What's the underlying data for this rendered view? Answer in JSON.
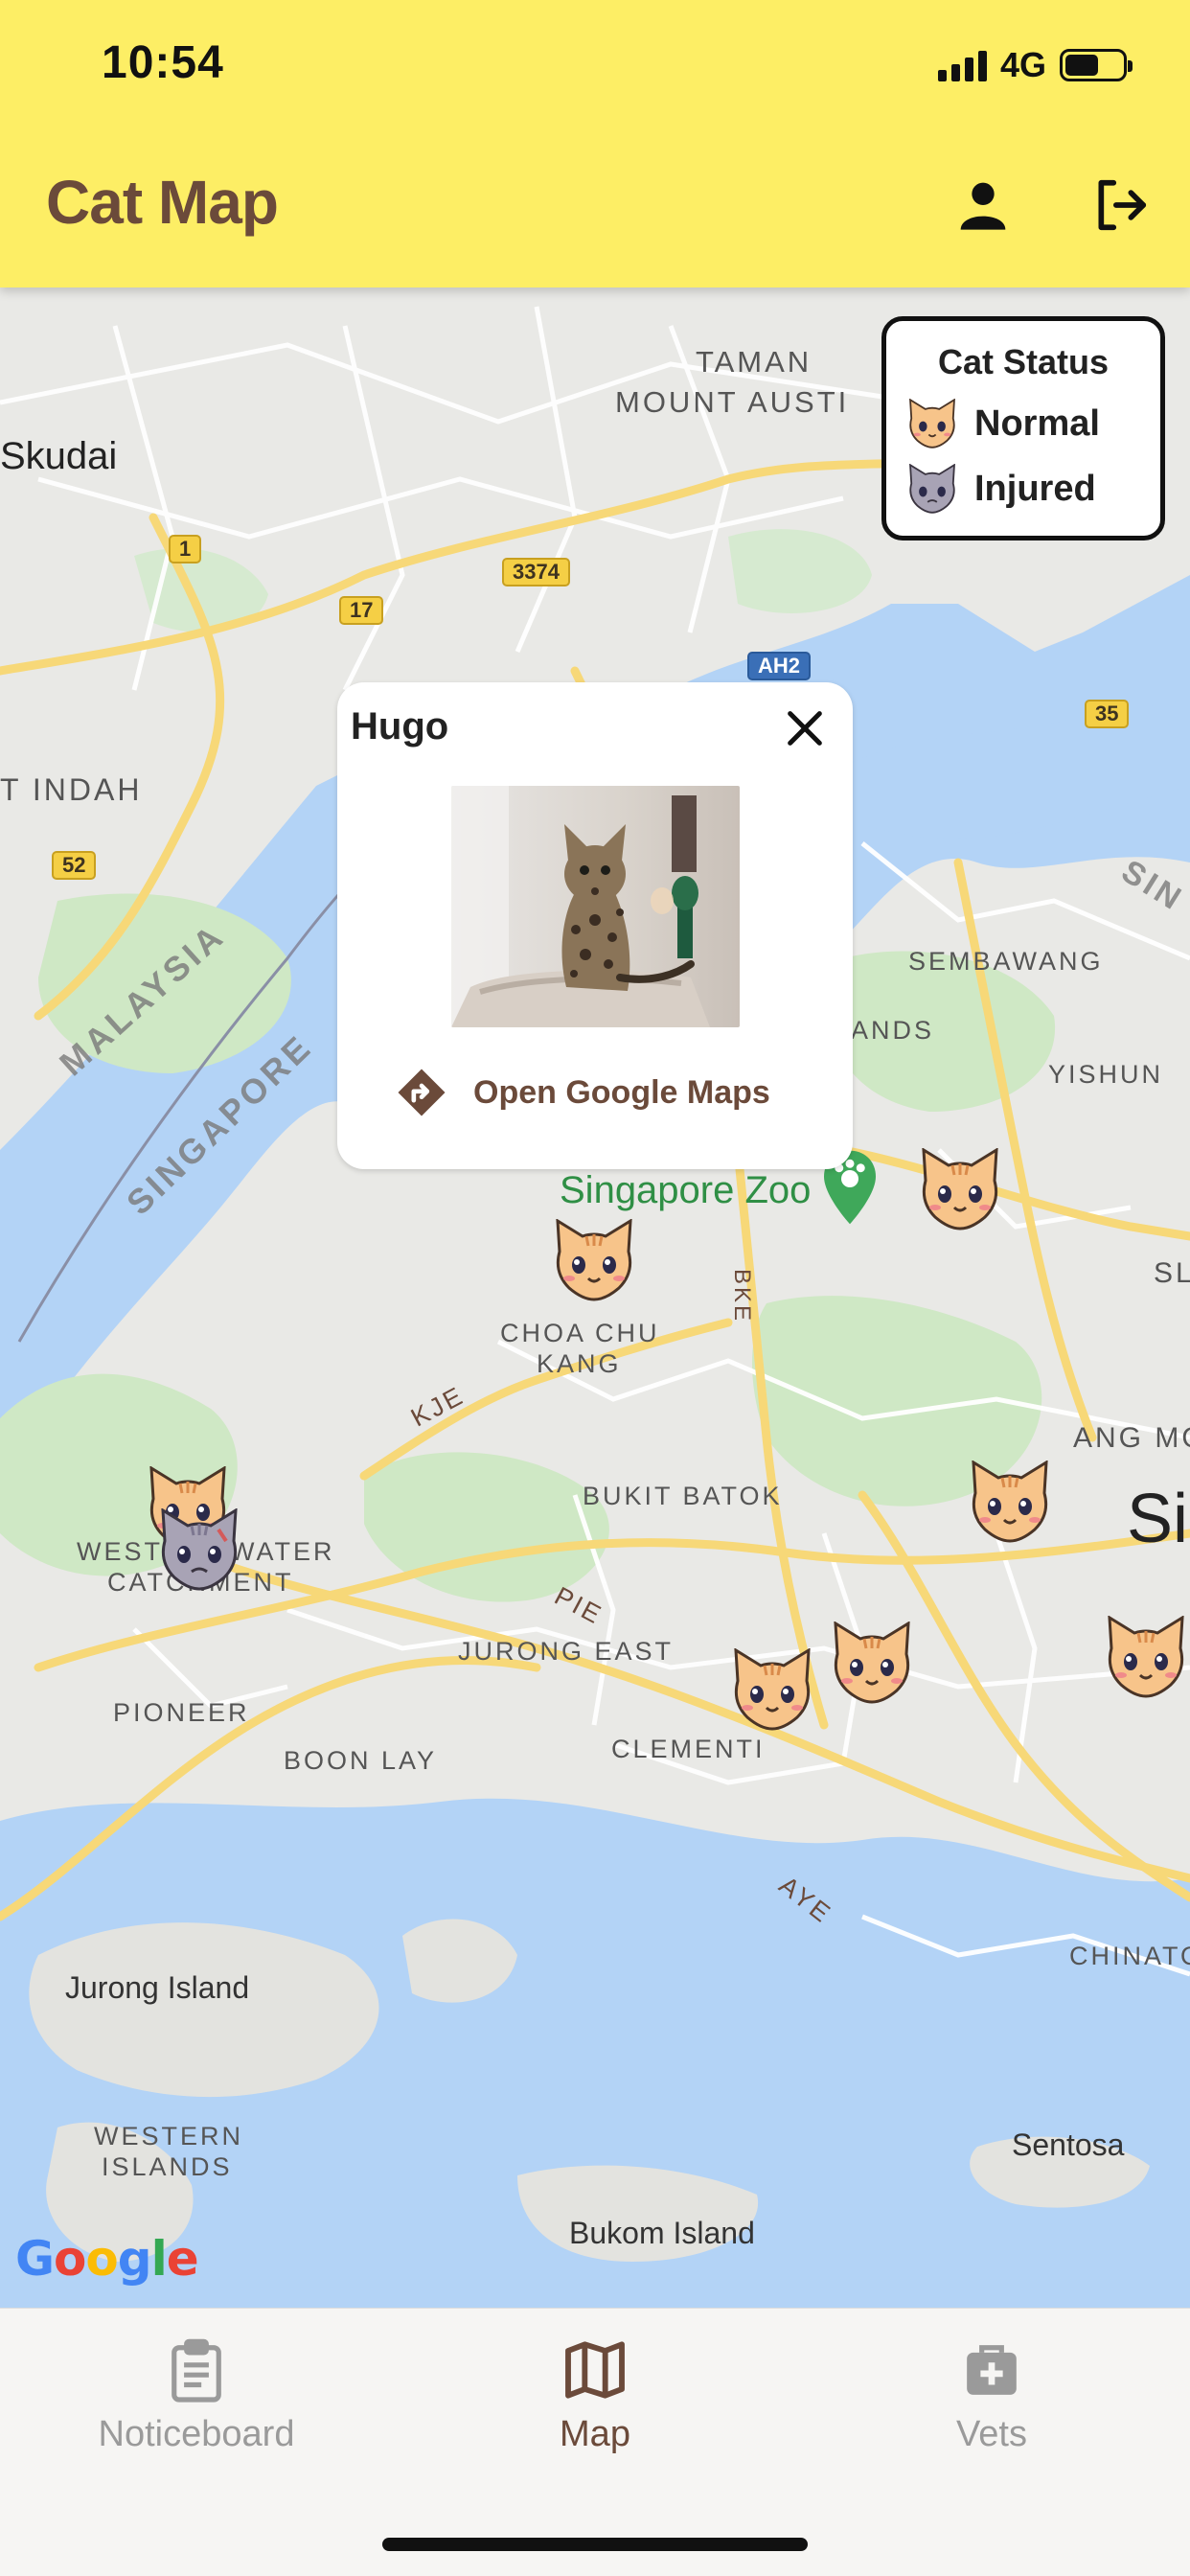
{
  "status_bar": {
    "time": "10:54",
    "network": "4G"
  },
  "header": {
    "title": "Cat Map",
    "profile_icon": "person-icon",
    "logout_icon": "logout-icon"
  },
  "legend": {
    "title": "Cat Status",
    "items": [
      {
        "label": "Normal",
        "icon": "normal-cat-icon",
        "color": "#f7c48a"
      },
      {
        "label": "Injured",
        "icon": "injured-cat-icon",
        "color": "#a8a3b5"
      }
    ]
  },
  "popup": {
    "name": "Hugo",
    "close_icon": "close-icon",
    "photo_alt": "photo of a cat",
    "link_label": "Open Google Maps",
    "link_icon": "directions-icon"
  },
  "map": {
    "labels": {
      "skudai": "Skudai",
      "taman_1": "TAMAN",
      "taman_2": "MOUNT AUSTI",
      "indah": "T INDAH",
      "sembawang": "SEMBAWANG",
      "yishun": "YISHUN",
      "ands": "ANDS",
      "zoo": "Singapore Zoo",
      "choa_1": "CHOA CHU",
      "choa_2": "KANG",
      "bukit_batok": "BUKIT BATOK",
      "west_1": "WEST",
      "west_1b": "WATER",
      "west_2": "CATCHMENT",
      "jurong_east": "JURONG EAST",
      "pioneer": "PIONEER",
      "boon_lay": "BOON LAY",
      "clementi": "CLEMENTI",
      "ang_mo": "ANG MO",
      "si": "Si",
      "chinatown": "CHINATO",
      "jurong_island": "Jurong Island",
      "western_1": "WESTERN",
      "western_2": "ISLANDS",
      "sentosa": "Sentosa",
      "bukom": "Bukom Island",
      "malaysia": "MALAYSIA",
      "singapore": "SINGAPORE",
      "sin_edge": "SIN",
      "sl_edge": "SL",
      "kje": "KJE",
      "pie": "PIE",
      "aye": "AYE",
      "bke": "BKE"
    },
    "shields": {
      "r1": "1",
      "r17": "17",
      "r3374": "3374",
      "ah2": "AH2",
      "r35": "35",
      "r52": "52"
    },
    "google_logo": "Google",
    "colors": {
      "water": "#b3d3f6",
      "land": "#e9e9e6",
      "park": "#cfe8c5",
      "road": "#f7d878",
      "street": "#ffffff"
    }
  },
  "bottom_nav": {
    "items": [
      {
        "label": "Noticeboard",
        "icon": "clipboard-icon",
        "active": false
      },
      {
        "label": "Map",
        "icon": "map-icon",
        "active": true
      },
      {
        "label": "Vets",
        "icon": "medical-kit-icon",
        "active": false
      }
    ]
  }
}
